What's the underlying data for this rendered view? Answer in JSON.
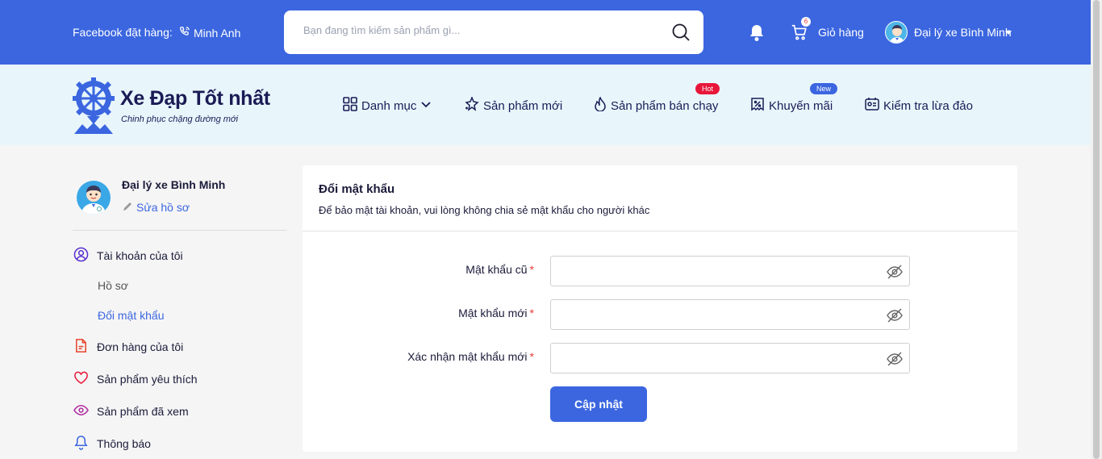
{
  "topbar": {
    "facebook_label": "Facebook đặt hàng:",
    "phone_label": "Minh Anh",
    "search_placeholder": "Bạn đang tìm kiếm sản phẩm gì...",
    "cart_count": "6",
    "cart_label": "Giỏ hàng",
    "user_name": "Đại lý xe Bình Minh",
    "bg_color": "#3b66e0"
  },
  "brand": {
    "title": "Xe Đạp Tốt nhất",
    "slogan": "Chinh phục chặng đường mới"
  },
  "nav": {
    "items": [
      {
        "label": "Danh mục",
        "icon": "grid-icon"
      },
      {
        "label": "Sản phẩm mới",
        "icon": "sparkle-icon"
      },
      {
        "label": "Sản phẩm bán chạy",
        "icon": "flame-icon",
        "badge": "Hot",
        "badge_color": "#e8173a"
      },
      {
        "label": "Khuyến mãi",
        "icon": "discount-icon",
        "badge": "New",
        "badge_color": "#3b66e0"
      },
      {
        "label": "Kiểm tra lừa đảo",
        "icon": "id-card-icon"
      }
    ]
  },
  "sidebar": {
    "user_name": "Đại lý xe Bình Minh",
    "edit_label": "Sửa hồ sơ",
    "items": [
      {
        "label": "Tài khoản của tôi",
        "icon": "user-circle-icon"
      },
      {
        "label": "Hồ sơ"
      },
      {
        "label": "Đổi mật khẩu",
        "active": true
      },
      {
        "label": "Đơn hàng của tôi",
        "icon": "document-icon"
      },
      {
        "label": "Sản phẩm yêu thích",
        "icon": "heart-icon"
      },
      {
        "label": "Sản phẩm đã xem",
        "icon": "eye-icon"
      },
      {
        "label": "Thông báo",
        "icon": "bell-icon"
      }
    ]
  },
  "form": {
    "title": "Đổi mật khẩu",
    "description": "Để bảo mật tài khoản, vui lòng không chia sẻ mật khẩu cho người khác",
    "fields": [
      {
        "label": "Mật khẩu cũ",
        "required": "*",
        "value": ""
      },
      {
        "label": "Mật khẩu mới",
        "required": "*",
        "value": ""
      },
      {
        "label": "Xác nhận mật khẩu mới",
        "required": "*",
        "value": ""
      }
    ],
    "submit_label": "Cập nhật"
  }
}
